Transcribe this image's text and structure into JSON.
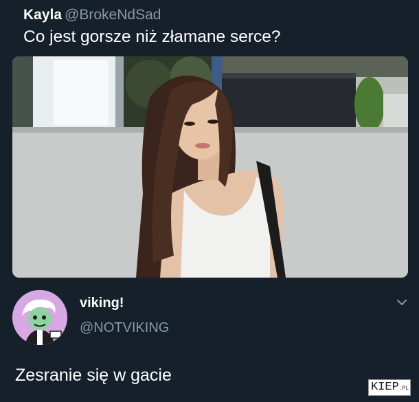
{
  "quoted_tweet": {
    "display_name": "Kayla",
    "handle": "@BrokeNdSad",
    "text": "Co jest gorsze niż złamane serce?",
    "photo_icon": "woman-photo"
  },
  "reply": {
    "display_name": "viking!",
    "handle": "@NOTVIKING",
    "text": "Zesranie się w gacie",
    "avatar_icon": "cartoon-avatar",
    "menu_icon": "chevron-down-icon"
  },
  "watermark": {
    "brand": "KIEP",
    "suffix": ".PL"
  },
  "colors": {
    "background": "#15202b",
    "text": "#ffffff",
    "muted": "#8899a6"
  }
}
